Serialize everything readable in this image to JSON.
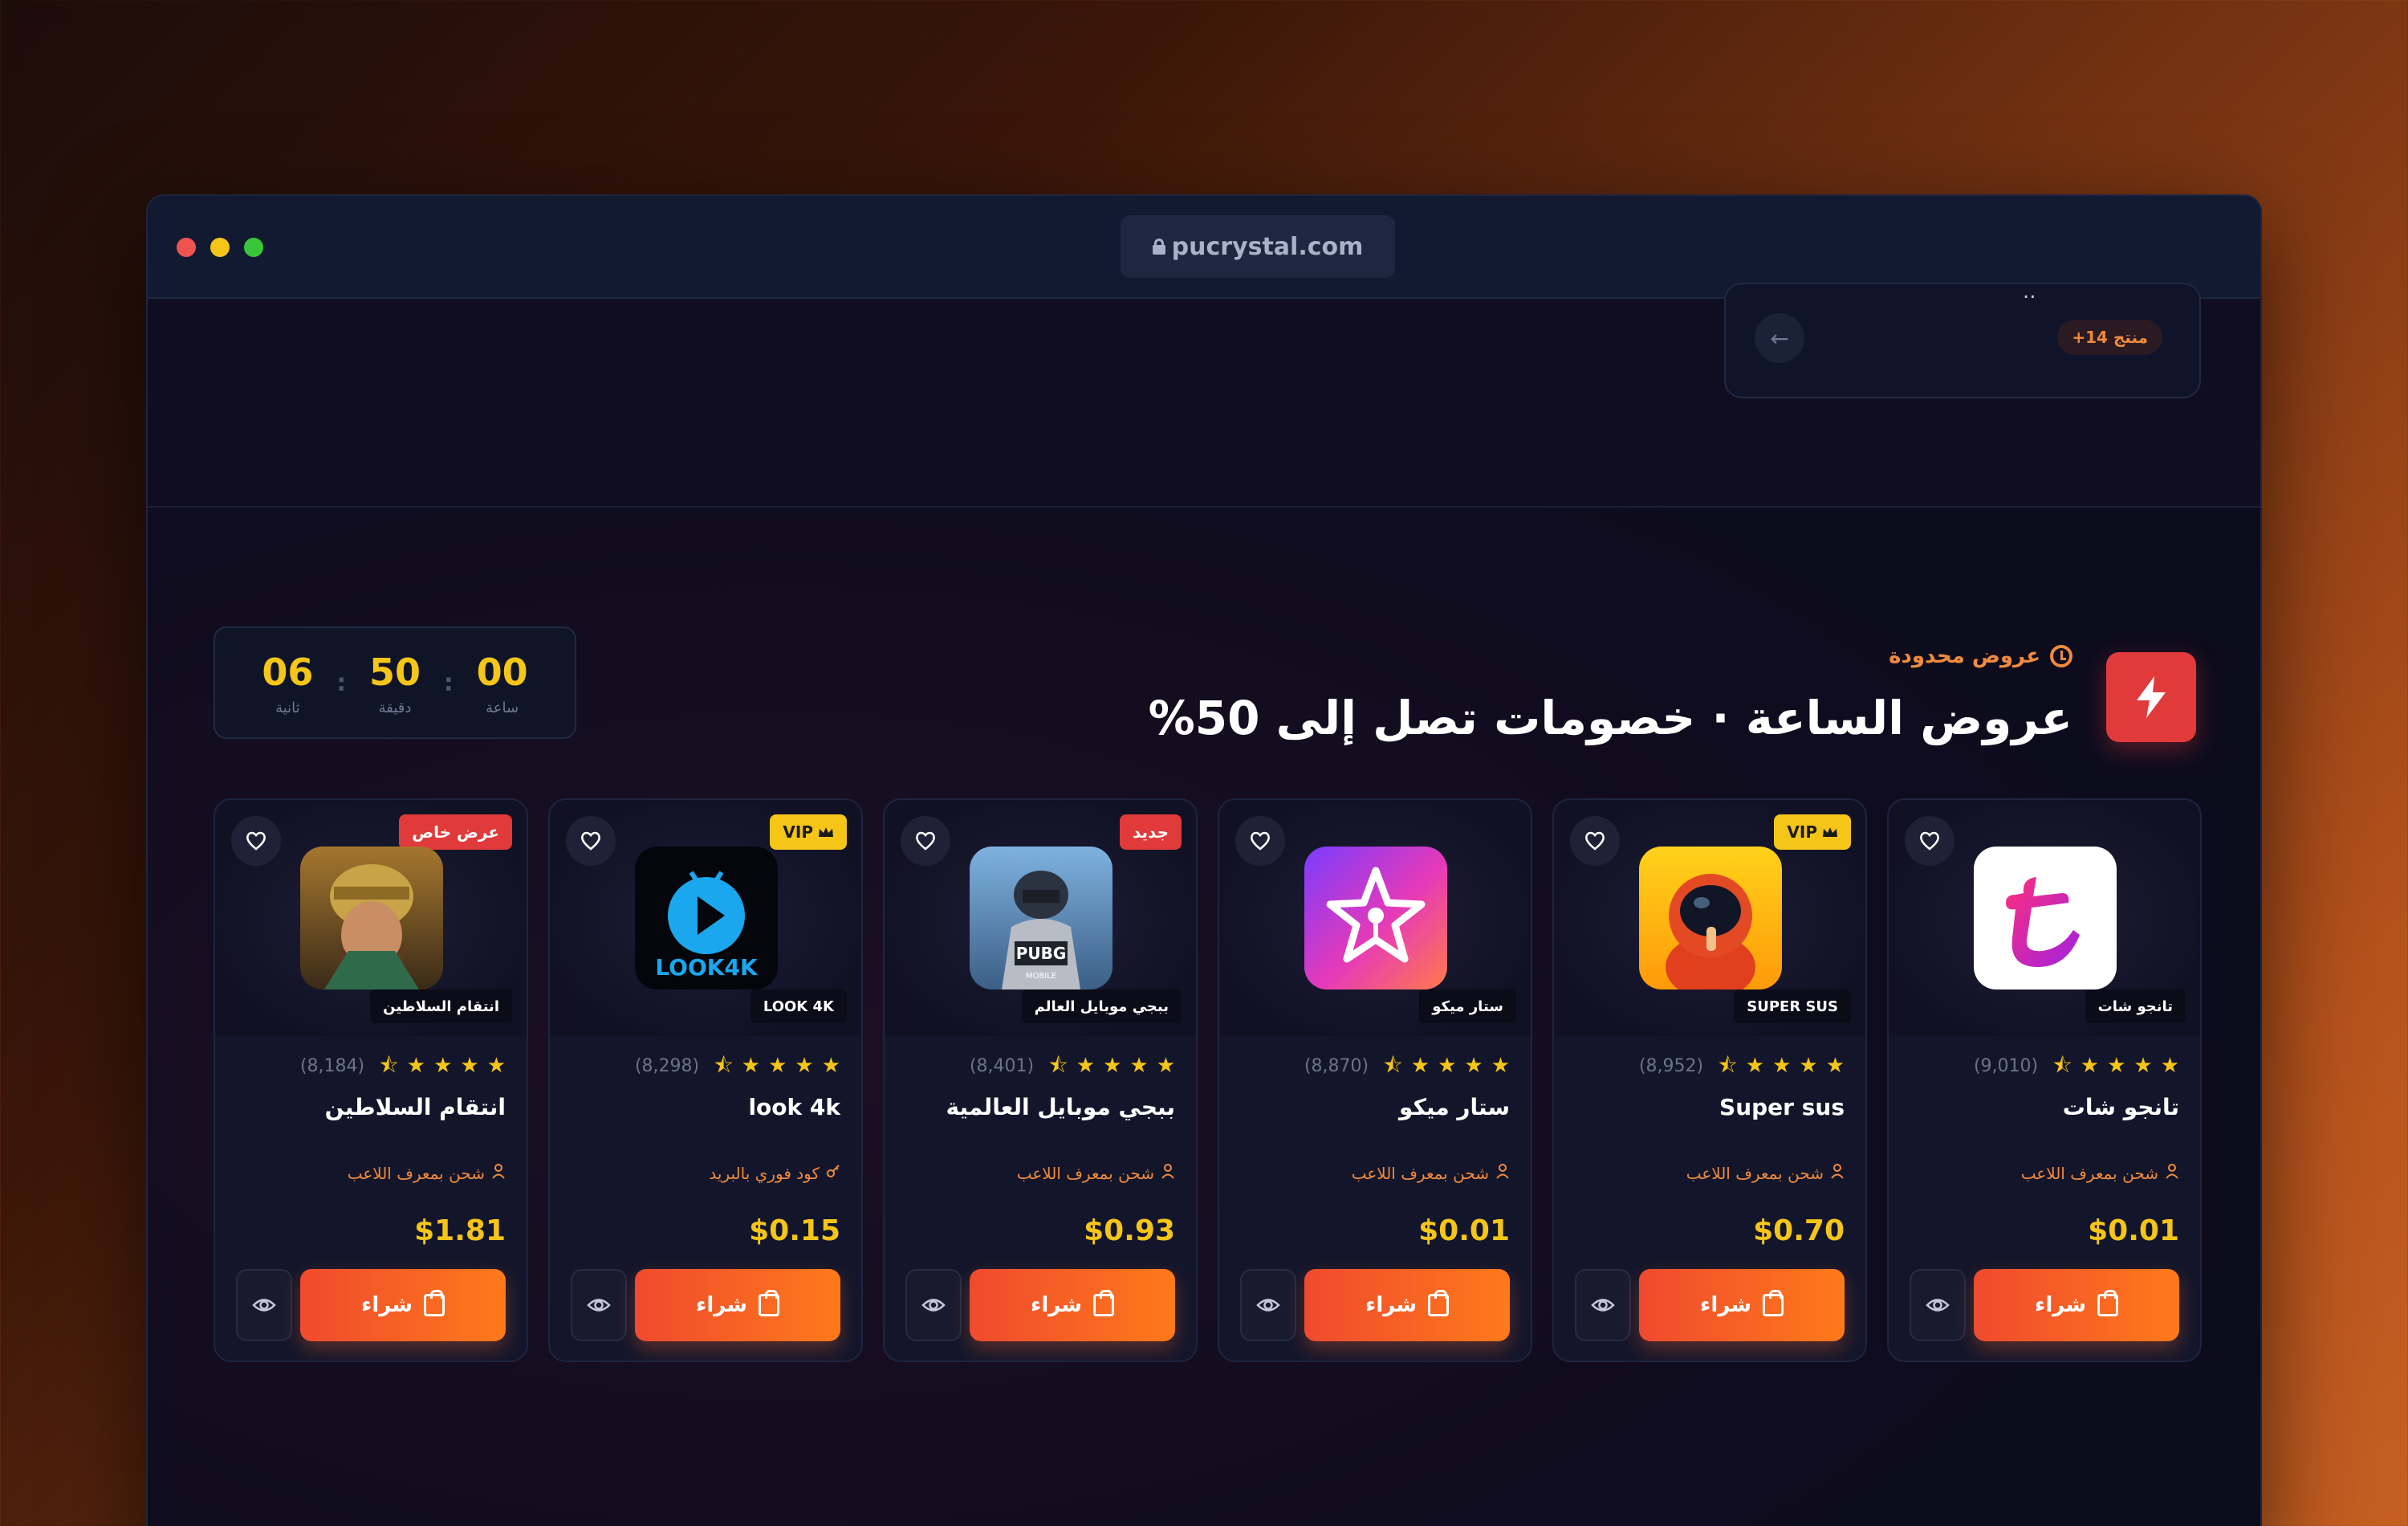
{
  "browser": {
    "url": "pucrystal.com"
  },
  "prev_section": {
    "fragment": "..",
    "count_badge": "+14 منتج"
  },
  "header": {
    "eyebrow": "عروض محدودة",
    "title": "عروض الساعة · خصومات تصل إلى 50%"
  },
  "timer": {
    "seconds": "06",
    "seconds_label": "ثانية",
    "minutes": "50",
    "minutes_label": "دقيقة",
    "hours": "00",
    "hours_label": "ساعة"
  },
  "products": [
    {
      "chip": "انتقام السلاطين",
      "badge": "عرض خاص",
      "badge_style": "red",
      "reviews": "(8,184)",
      "title": "انتقام السلاطين",
      "delivery": "شحن بمعرف اللاعب",
      "price": "$1.81",
      "buy": "شراء",
      "art": "sultan",
      "rating_stars": 4.5
    },
    {
      "chip": "LOOK 4K",
      "badge": "VIP",
      "badge_style": "gold",
      "reviews": "(8,298)",
      "title": "look 4k",
      "delivery": "كود فوري بالبريد",
      "price": "$0.15",
      "buy": "شراء",
      "art": "look4k",
      "rating_stars": 4.5
    },
    {
      "chip": "ببجي موبايل العالم",
      "badge": "جديد",
      "badge_style": "red",
      "reviews": "(8,401)",
      "title": "ببجي موبايل العالمية",
      "delivery": "شحن بمعرف اللاعب",
      "price": "$0.93",
      "buy": "شراء",
      "art": "pubg",
      "rating_stars": 4.5
    },
    {
      "chip": "ستار ميكو",
      "badge": "",
      "badge_style": "",
      "reviews": "(8,870)",
      "title": "ستار ميكو",
      "delivery": "شحن بمعرف اللاعب",
      "price": "$0.01",
      "buy": "شراء",
      "art": "starmaker",
      "rating_stars": 4.5
    },
    {
      "chip": "SUPER SUS",
      "badge": "VIP",
      "badge_style": "gold",
      "reviews": "(8,952)",
      "title": "Super sus",
      "delivery": "شحن بمعرف اللاعب",
      "price": "$0.70",
      "buy": "شراء",
      "art": "supersus",
      "rating_stars": 4.5
    },
    {
      "chip": "تانجو شات",
      "badge": "",
      "badge_style": "",
      "reviews": "(9,010)",
      "title": "تانجو شات",
      "delivery": "شحن بمعرف اللاعب",
      "price": "$0.01",
      "buy": "شراء",
      "art": "tango",
      "rating_stars": 4.5
    }
  ],
  "colors": {
    "accent": "#f08a3e",
    "gold": "#f5c518",
    "badge_red": "#e03a3a"
  }
}
